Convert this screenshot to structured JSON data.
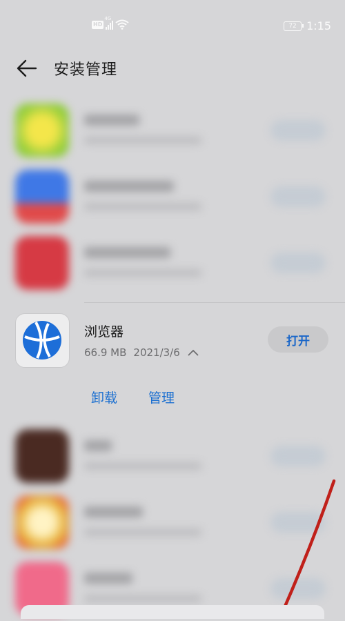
{
  "status_bar": {
    "hd_badge": "HD",
    "network_type": "4G",
    "battery_level": "72",
    "time": "1:15"
  },
  "header": {
    "title": "安装管理"
  },
  "expanded_app": {
    "name": "浏览器",
    "size": "66.9 MB",
    "date": "2021/3/6",
    "open_label": "打开",
    "uninstall_label": "卸载",
    "manage_label": "管理"
  },
  "colors": {
    "accent": "#1b6fd0",
    "annotation_stroke": "#c0201a"
  }
}
